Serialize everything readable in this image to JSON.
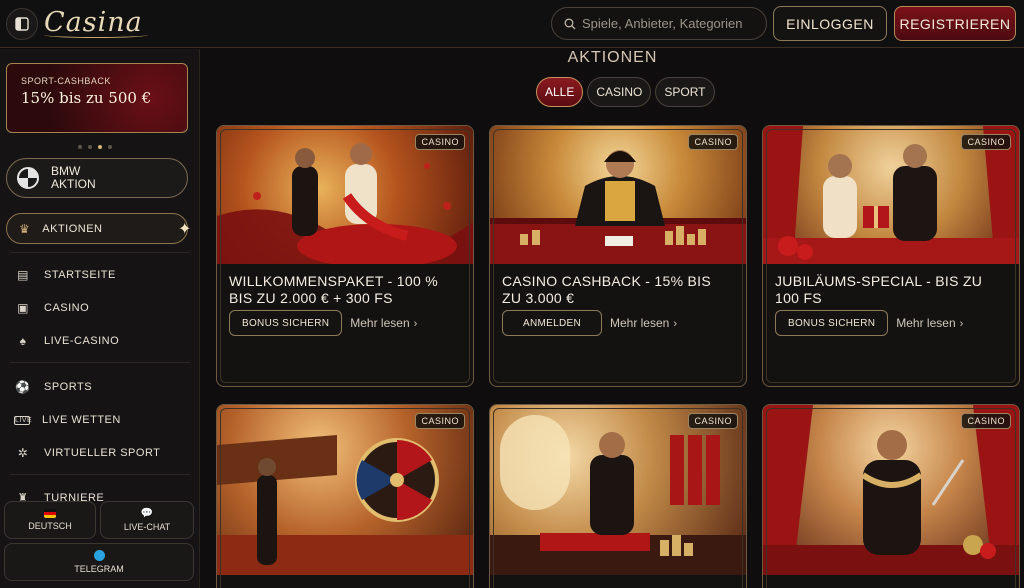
{
  "header": {
    "logo": "Casina",
    "search_placeholder": "Spiele, Anbieter, Kategorien",
    "login_label": "EINLOGGEN",
    "register_label": "REGISTRIEREN"
  },
  "sidebar": {
    "promo": {
      "small": "SPORT-CASHBACK",
      "big": "15% bis zu 500 €"
    },
    "bmw": {
      "line1": "BMW",
      "line2": "AKTION"
    },
    "aktionen": "AKTIONEN",
    "nav": [
      {
        "label": "STARTSEITE",
        "icon": "home-icon"
      },
      {
        "label": "CASINO",
        "icon": "slot-icon"
      },
      {
        "label": "LIVE-CASINO",
        "icon": "cards-icon"
      },
      {
        "label": "SPORTS",
        "icon": "ball-icon"
      },
      {
        "label": "LIVE WETTEN",
        "icon": "live-icon"
      },
      {
        "label": "VIRTUELLER SPORT",
        "icon": "virtual-icon"
      },
      {
        "label": "TURNIERE",
        "icon": "trophy-icon"
      }
    ],
    "bottom": {
      "language": "DEUTSCH",
      "chat": "LIVE-CHAT",
      "telegram": "TELEGRAM"
    }
  },
  "main": {
    "title": "AKTIONEN",
    "filters": [
      "ALLE",
      "CASINO",
      "SPORT"
    ],
    "active_filter": "ALLE",
    "cards": [
      {
        "badge": "CASINO",
        "title": "WILLKOMMENSPAKET - 100 % BIS ZU 2.000 € + 300 FS",
        "button": "BONUS SICHERN",
        "more": "Mehr lesen"
      },
      {
        "badge": "CASINO",
        "title": "CASINO CASHBACK - 15% BIS ZU 3.000 €",
        "button": "ANMELDEN",
        "more": "Mehr lesen"
      },
      {
        "badge": "CASINO",
        "title": "JUBILÄUMS-SPECIAL - BIS ZU 100 FS",
        "button": "BONUS SICHERN",
        "more": "Mehr lesen"
      },
      {
        "badge": "CASINO",
        "title": "",
        "button": "",
        "more": ""
      },
      {
        "badge": "CASINO",
        "title": "",
        "button": "",
        "more": ""
      },
      {
        "badge": "CASINO",
        "title": "",
        "button": "",
        "more": ""
      }
    ]
  },
  "colors": {
    "accent_red": "#7b1118",
    "gold": "#d9b77a",
    "background": "#0e0c0c"
  }
}
